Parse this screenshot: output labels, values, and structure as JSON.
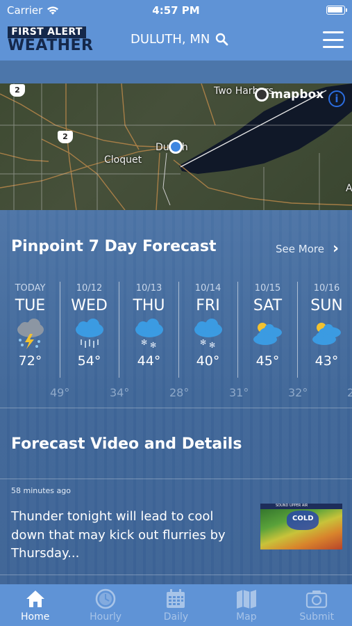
{
  "status_bar": {
    "carrier": "Carrier",
    "time": "4:57 PM"
  },
  "header": {
    "logo_line1": "FIRST ALERT",
    "logo_line2": "WEATHER",
    "location": "DULUTH, MN"
  },
  "map": {
    "attribution": "mapbox",
    "labels": {
      "two_harbors": "Two Harbors",
      "duluth": "Duluth",
      "cloquet": "Cloquet",
      "route_2a": "2",
      "route_2b": "2",
      "edge_letter": "A"
    }
  },
  "forecast": {
    "title": "Pinpoint 7 Day Forecast",
    "see_more": "See More",
    "days": [
      {
        "date": "TODAY",
        "name": "TUE",
        "icon": "thunderstorm-icon",
        "hi": "72°",
        "lo": "49°"
      },
      {
        "date": "10/12",
        "name": "WED",
        "icon": "rain-icon",
        "hi": "54°",
        "lo": "34°"
      },
      {
        "date": "10/13",
        "name": "THU",
        "icon": "snow-icon",
        "hi": "44°",
        "lo": "28°"
      },
      {
        "date": "10/14",
        "name": "FRI",
        "icon": "snow-icon",
        "hi": "40°",
        "lo": "31°"
      },
      {
        "date": "10/15",
        "name": "SAT",
        "icon": "partly-cloudy-icon",
        "hi": "45°",
        "lo": "32°"
      },
      {
        "date": "10/16",
        "name": "SUN",
        "icon": "partly-cloudy-icon",
        "hi": "43°",
        "lo": "2"
      }
    ]
  },
  "video": {
    "title": "Forecast Video and Details",
    "age": "58 minutes ago",
    "headline": "Thunder tonight will lead to cool down that may kick out flurries by Thursday...",
    "thumb_text": "COLD",
    "thumb_header": "SOUND UPPER AIR"
  },
  "tabs": [
    {
      "label": "Home",
      "icon": "home-icon",
      "active": true
    },
    {
      "label": "Hourly",
      "icon": "clock-icon",
      "active": false
    },
    {
      "label": "Daily",
      "icon": "calendar-icon",
      "active": false
    },
    {
      "label": "Map",
      "icon": "map-icon",
      "active": false
    },
    {
      "label": "Submit",
      "icon": "camera-icon",
      "active": false
    }
  ],
  "colors": {
    "header_bg": "#5f93d6",
    "page_bg": "#3d6698",
    "logo_dark": "#14284b"
  }
}
